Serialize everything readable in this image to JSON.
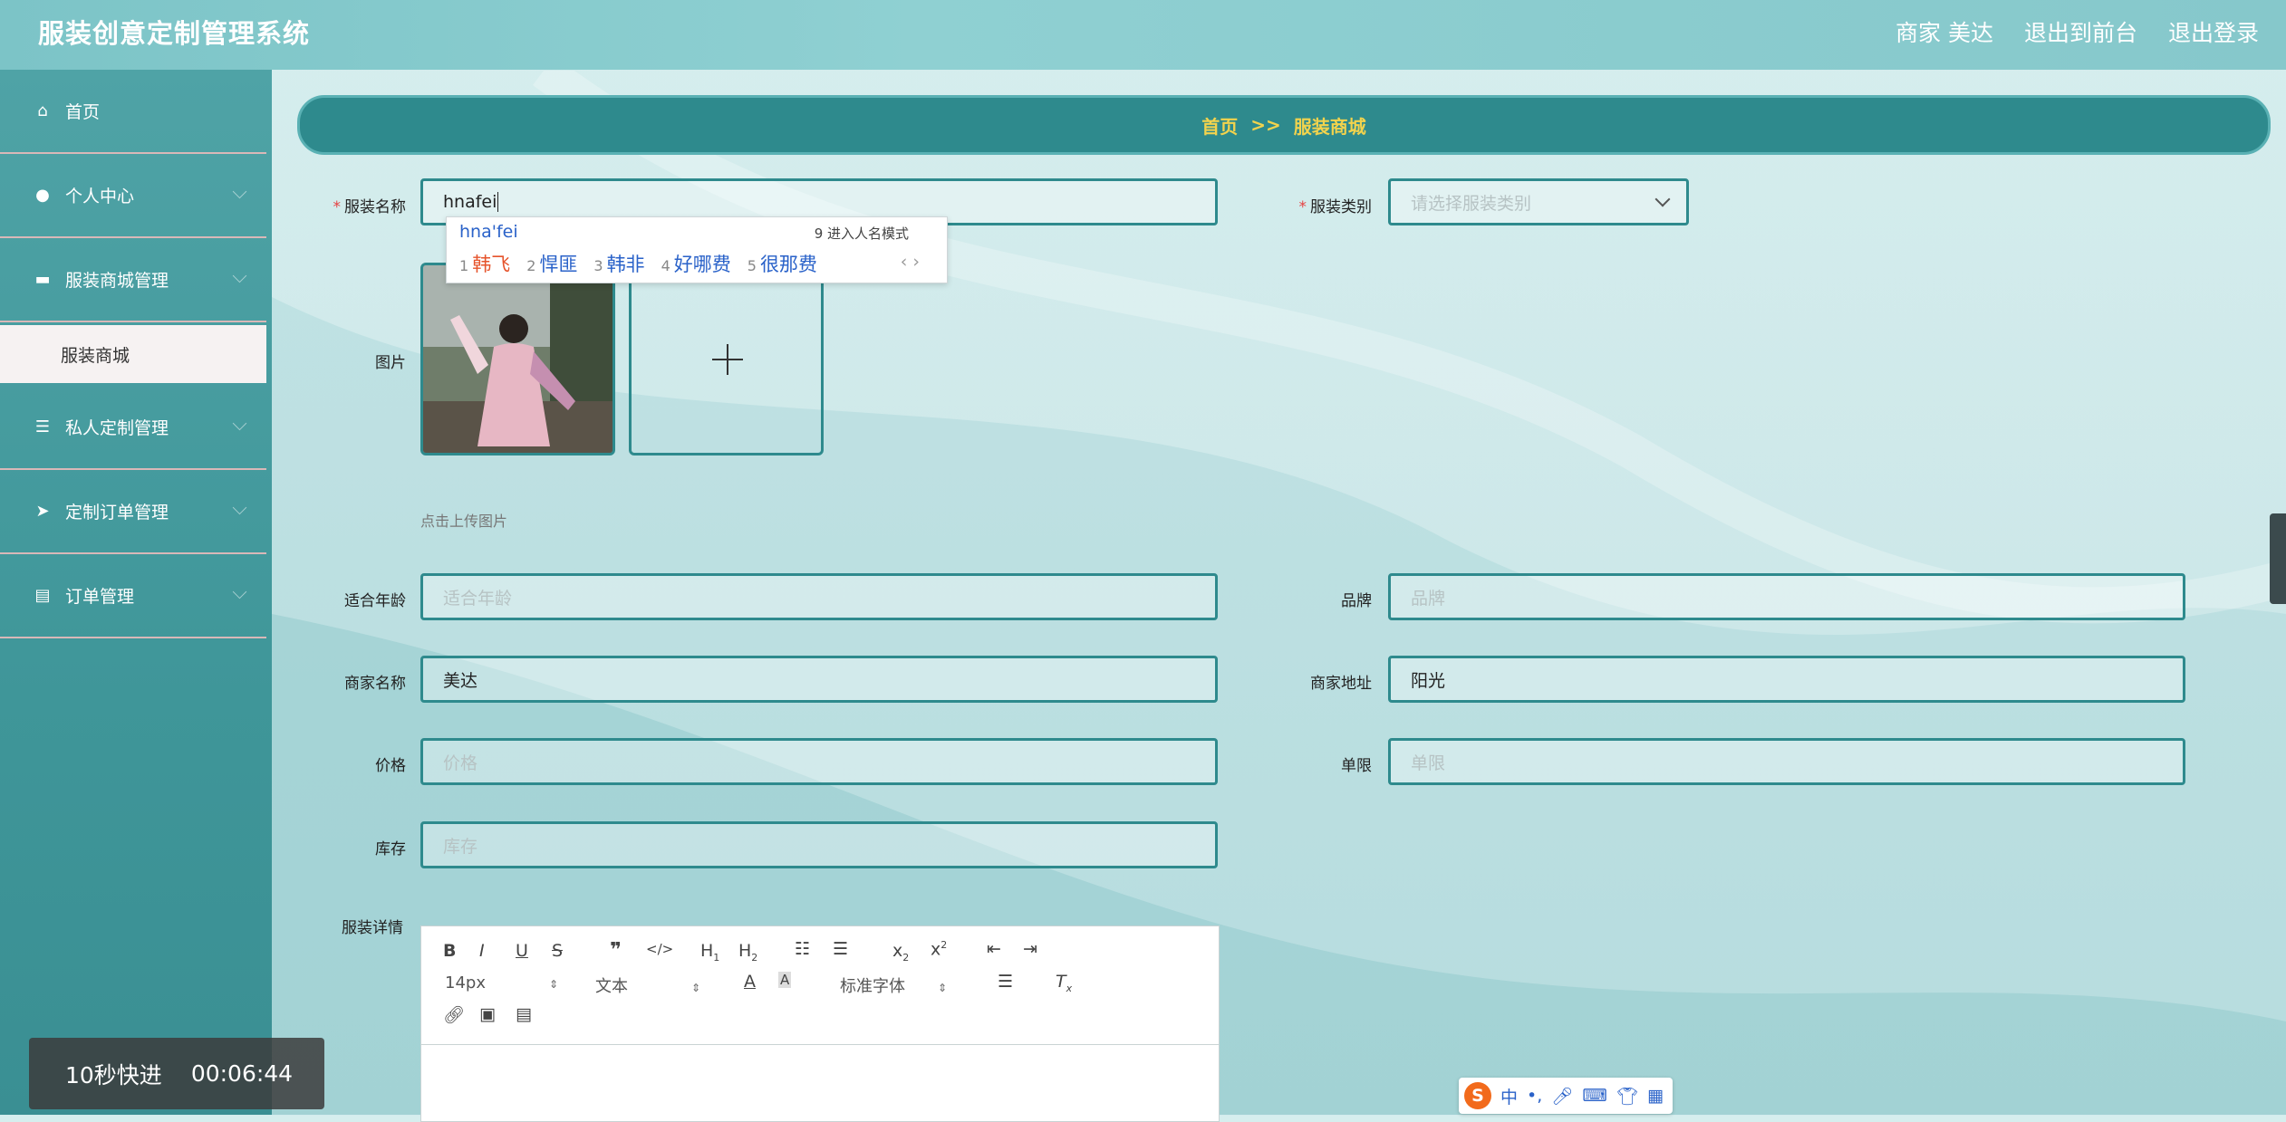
{
  "app": {
    "title": "服装创意定制管理系统",
    "top_links": [
      "商家 美达",
      "退出到前台",
      "退出登录"
    ]
  },
  "sidebar": {
    "items": [
      {
        "label": "首页",
        "icon": "home-icon"
      },
      {
        "label": "个人中心",
        "icon": "user-icon"
      },
      {
        "label": "服装商城管理",
        "icon": "chat-icon"
      },
      {
        "label": "私人定制管理",
        "icon": "list-icon"
      },
      {
        "label": "定制订单管理",
        "icon": "send-icon"
      },
      {
        "label": "订单管理",
        "icon": "print-icon"
      }
    ],
    "active_sub": "服装商城"
  },
  "breadcrumb": {
    "home": "首页",
    "sep": ">>",
    "current": "服装商城"
  },
  "form": {
    "name_label": "服装名称",
    "name_value": "hnafei",
    "category_label": "服装类别",
    "category_placeholder": "请选择服装类别",
    "image_label": "图片",
    "upload_hint": "点击上传图片",
    "age_label": "适合年龄",
    "age_placeholder": "适合年龄",
    "brand_label": "品牌",
    "brand_placeholder": "品牌",
    "merchant_label": "商家名称",
    "merchant_value": "美达",
    "address_label": "商家地址",
    "address_value": "阳光",
    "price_label": "价格",
    "price_placeholder": "价格",
    "limit_label": "单限",
    "limit_placeholder": "单限",
    "stock_label": "库存",
    "stock_placeholder": "库存",
    "detail_label": "服装详情"
  },
  "ime": {
    "pinyin": "hna'fei",
    "mode": "9 进入人名模式",
    "candidates": [
      {
        "n": "1",
        "text": "韩飞"
      },
      {
        "n": "2",
        "text": "悍匪"
      },
      {
        "n": "3",
        "text": "韩非"
      },
      {
        "n": "4",
        "text": "好哪费"
      },
      {
        "n": "5",
        "text": "很那费"
      }
    ]
  },
  "editor": {
    "font_size": "14px",
    "paragraph": "文本",
    "font_family": "标准字体"
  },
  "video": {
    "skip": "10秒快进",
    "time": "00:06:44"
  },
  "ime_bar": {
    "label": "中"
  },
  "colors": {
    "accent": "#2e8a8d",
    "breadcrumb_text": "#f2d34d",
    "required": "#e64242"
  }
}
